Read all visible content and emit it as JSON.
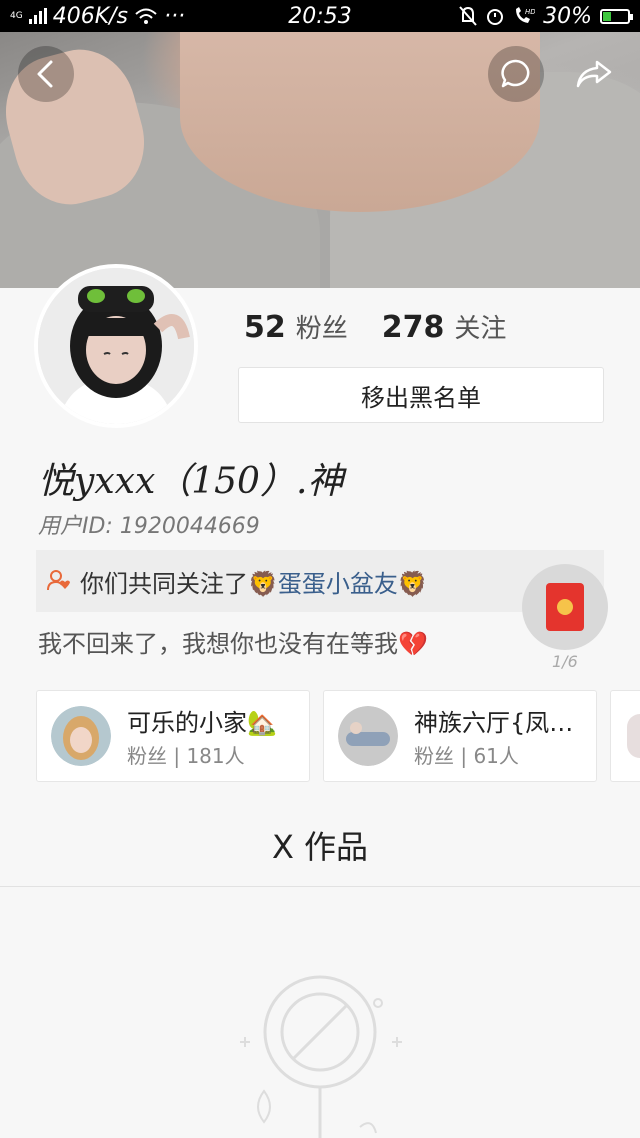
{
  "status_bar": {
    "network_type": "4G",
    "speed": "406K/s",
    "more": "···",
    "time": "20:53",
    "battery": "30%",
    "battery_level": 0.3,
    "hd_tag": "HD"
  },
  "header": {
    "back_icon": "chevron-left-icon",
    "comment_icon": "chat-bubble-icon",
    "share_icon": "share-arrow-icon"
  },
  "profile": {
    "fans_count": "52",
    "fans_label": "粉丝",
    "following_count": "278",
    "following_label": "关注",
    "unblock_label": "移出黑名单",
    "nickname": "悦yxxx（150）.神",
    "user_id": "用户ID: 1920044669",
    "mutual_prefix": "你们共同关注了",
    "mutual_name": "🦁蛋蛋小盆友🦁",
    "bio": "我不回来了，我想你也没有在等我💔"
  },
  "red_packet": {
    "count": "1/6",
    "colors": {
      "envelope": "#e4342d",
      "coin": "#f6c34a"
    }
  },
  "friends": [
    {
      "name": "可乐的小家🏡",
      "fans": "粉丝 | 181人"
    },
    {
      "name": "神族六厅{凤…",
      "fans": "粉丝 | 61人"
    }
  ],
  "works": {
    "title": "X 作品"
  },
  "colors": {
    "link": "#3a5f8c",
    "accent": "#e4342d"
  }
}
